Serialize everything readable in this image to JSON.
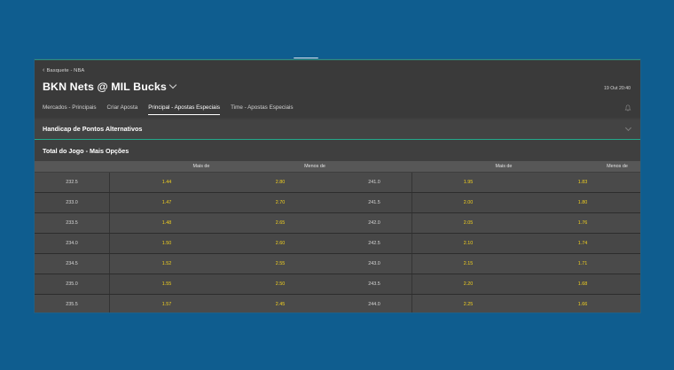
{
  "breadcrumb": {
    "label": "Basquete - NBA"
  },
  "event": {
    "title": "BKN Nets @ MIL Bucks",
    "date": "19 Out 20:40"
  },
  "tabs": [
    {
      "label": "Mercados - Principais"
    },
    {
      "label": "Criar Aposta"
    },
    {
      "label": "Principal - Apostas Especiais"
    },
    {
      "label": "Time - Apostas Especiais"
    }
  ],
  "sections": {
    "handicap": "Handicap de Pontos Alternativos",
    "total": "Total do Jogo - Mais Opções"
  },
  "columns": {
    "over": "Mais de",
    "under": "Menos de"
  },
  "rows": [
    {
      "l1": "232.5",
      "o1": "1.44",
      "u1": "2.80",
      "l2": "241.0",
      "o2": "1.95",
      "u2": "1.83"
    },
    {
      "l1": "233.0",
      "o1": "1.47",
      "u1": "2.70",
      "l2": "241.5",
      "o2": "2.00",
      "u2": "1.80"
    },
    {
      "l1": "233.5",
      "o1": "1.48",
      "u1": "2.65",
      "l2": "242.0",
      "o2": "2.05",
      "u2": "1.76"
    },
    {
      "l1": "234.0",
      "o1": "1.50",
      "u1": "2.60",
      "l2": "242.5",
      "o2": "2.10",
      "u2": "1.74"
    },
    {
      "l1": "234.5",
      "o1": "1.52",
      "u1": "2.55",
      "l2": "243.0",
      "o2": "2.15",
      "u2": "1.71"
    },
    {
      "l1": "235.0",
      "o1": "1.55",
      "u1": "2.50",
      "l2": "243.5",
      "o2": "2.20",
      "u2": "1.68"
    },
    {
      "l1": "235.5",
      "o1": "1.57",
      "u1": "2.45",
      "l2": "244.0",
      "o2": "2.25",
      "u2": "1.66"
    }
  ],
  "colors": {
    "odds": "#f3d11f",
    "accent": "#24a88b",
    "background": "#0f5d8f"
  }
}
